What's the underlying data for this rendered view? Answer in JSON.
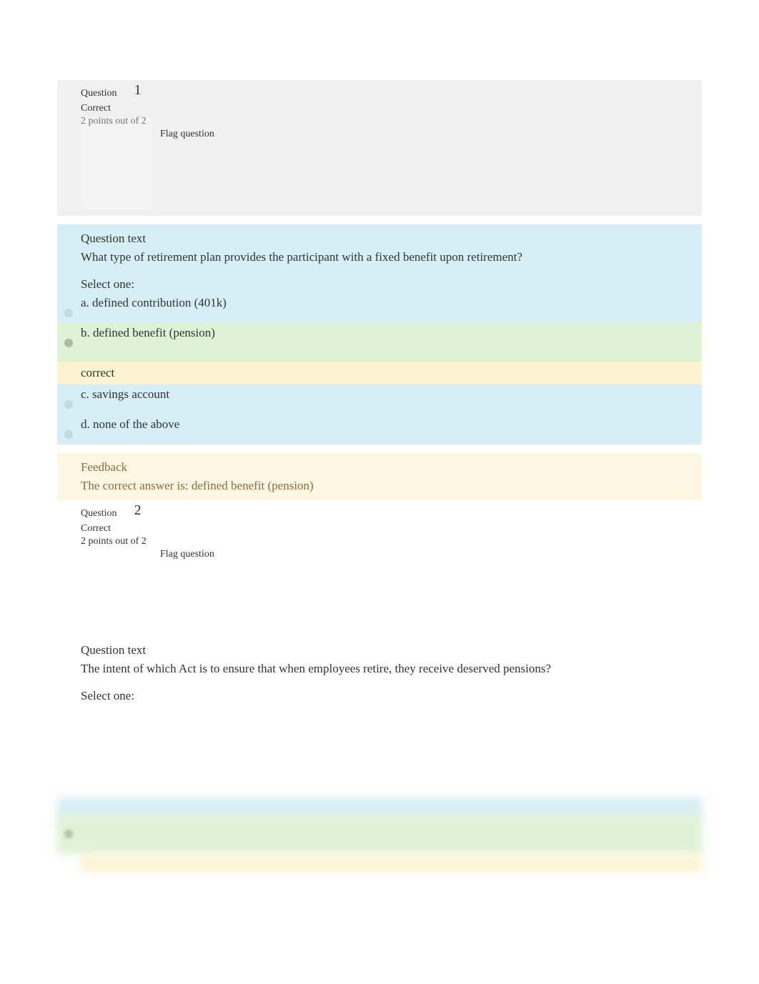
{
  "q1": {
    "label": "Question",
    "number": "1",
    "status": "Correct",
    "points": "2 points out of 2",
    "flag": "Flag question",
    "text_heading": "Question text",
    "text": "What type of retirement plan provides the participant with a fixed benefit upon retirement?",
    "select_one": "Select one:",
    "options": {
      "a": "a. defined contribution (401k)",
      "b": "b. defined benefit (pension)",
      "c": "c. savings account",
      "d": "d. none of the above"
    },
    "correct_label": "correct",
    "feedback_heading": "Feedback",
    "feedback_text": "The correct answer is: defined benefit (pension)"
  },
  "q2": {
    "label": "Question",
    "number": "2",
    "status": "Correct",
    "points": "2 points out of 2",
    "flag": "Flag question",
    "text_heading": "Question text",
    "text": "The intent of which Act is to ensure that when employees retire, they receive deserved pensions?",
    "select_one": "Select one:"
  }
}
